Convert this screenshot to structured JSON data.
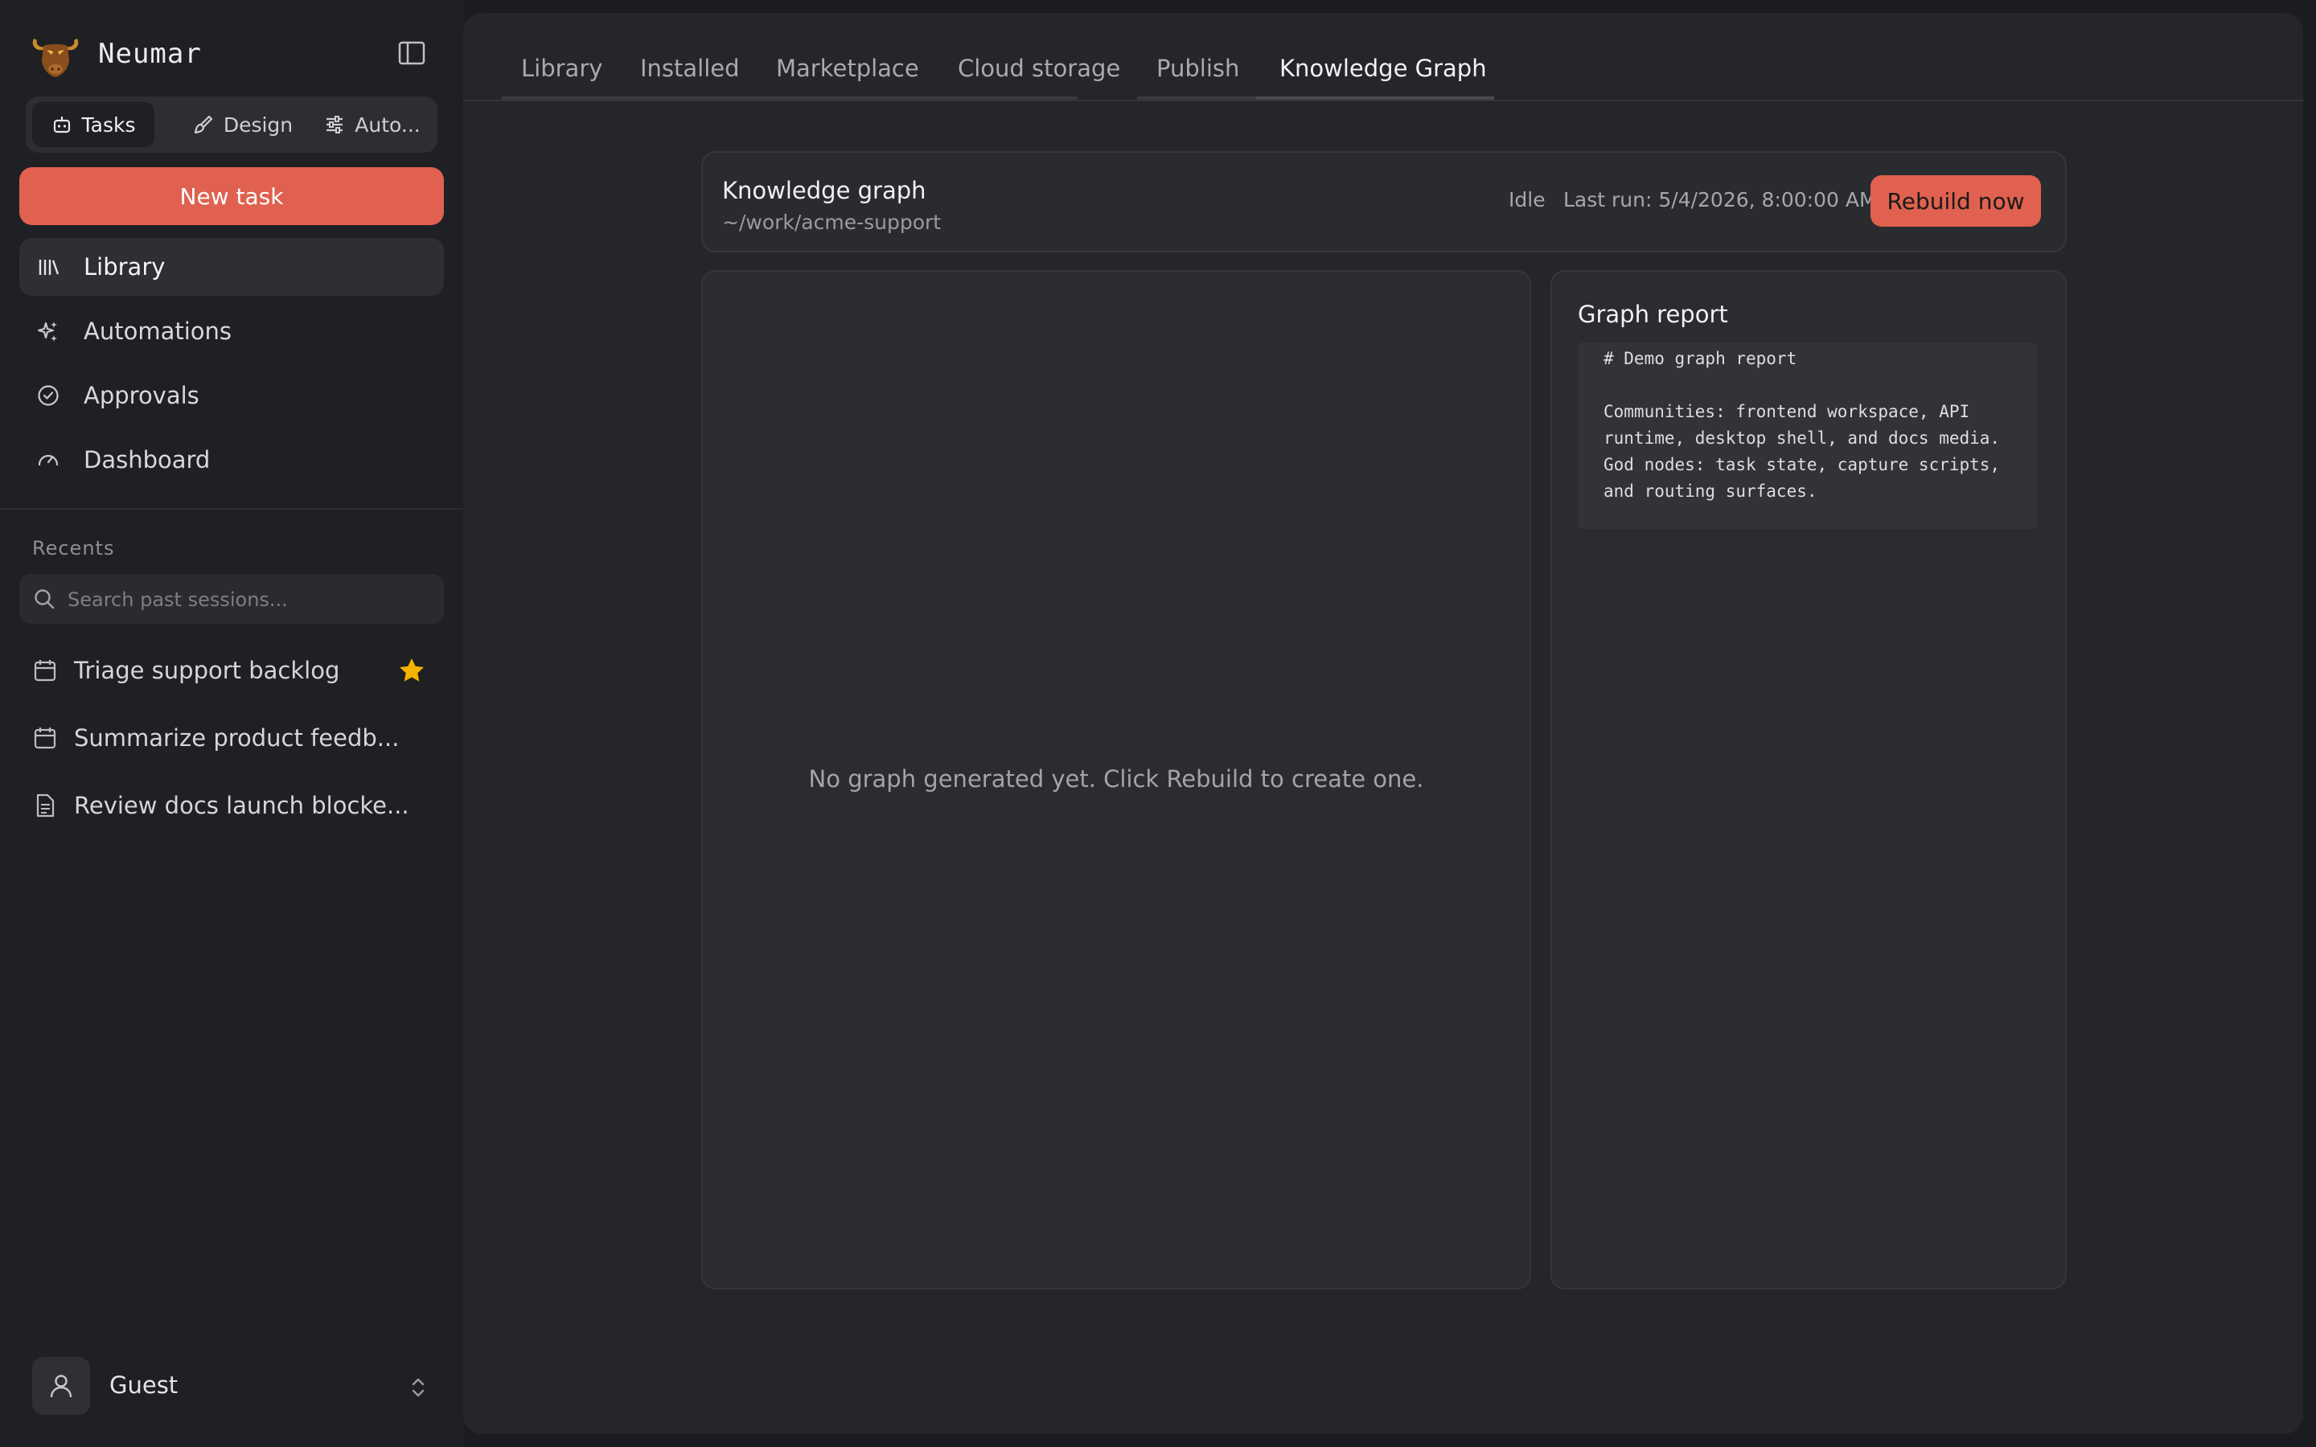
{
  "app": {
    "name": "Neumar"
  },
  "modes": [
    {
      "label": "Tasks",
      "icon": "robot-icon"
    },
    {
      "label": "Design",
      "icon": "brush-icon"
    },
    {
      "label": "Auto...",
      "icon": "sliders-icon"
    }
  ],
  "sidebar": {
    "new_task_label": "New task",
    "nav": [
      {
        "label": "Library",
        "icon": "library-icon"
      },
      {
        "label": "Automations",
        "icon": "sparkles-icon"
      },
      {
        "label": "Approvals",
        "icon": "check-circle-icon"
      },
      {
        "label": "Dashboard",
        "icon": "gauge-icon"
      }
    ],
    "recents_title": "Recents",
    "search_placeholder": "Search past sessions...",
    "recents": [
      {
        "label": "Triage support backlog",
        "icon": "calendar-icon",
        "starred": true
      },
      {
        "label": "Summarize product feedb...",
        "icon": "calendar-icon",
        "starred": false
      },
      {
        "label": "Review docs launch blocke...",
        "icon": "document-icon",
        "starred": false
      }
    ],
    "user": {
      "name": "Guest"
    }
  },
  "tabs": [
    {
      "label": "Library"
    },
    {
      "label": "Installed"
    },
    {
      "label": "Marketplace"
    },
    {
      "label": "Cloud storage"
    },
    {
      "label": "Publish"
    },
    {
      "label": "Knowledge Graph"
    }
  ],
  "knowledge_graph": {
    "title": "Knowledge graph",
    "path": "~/work/acme-support",
    "status": "Idle",
    "last_run": "Last run: 5/4/2026, 8:00:00 AM",
    "rebuild_label": "Rebuild now",
    "empty_message": "No graph generated yet. Click Rebuild to create one.",
    "report_title": "Graph report",
    "report_text": "# Demo graph report\n\nCommunities: frontend workspace, API runtime, desktop shell, and docs media.\nGod nodes: task state, capture scripts, and routing surfaces."
  },
  "colors": {
    "accent": "#e0614f",
    "star": "#f5b301"
  }
}
